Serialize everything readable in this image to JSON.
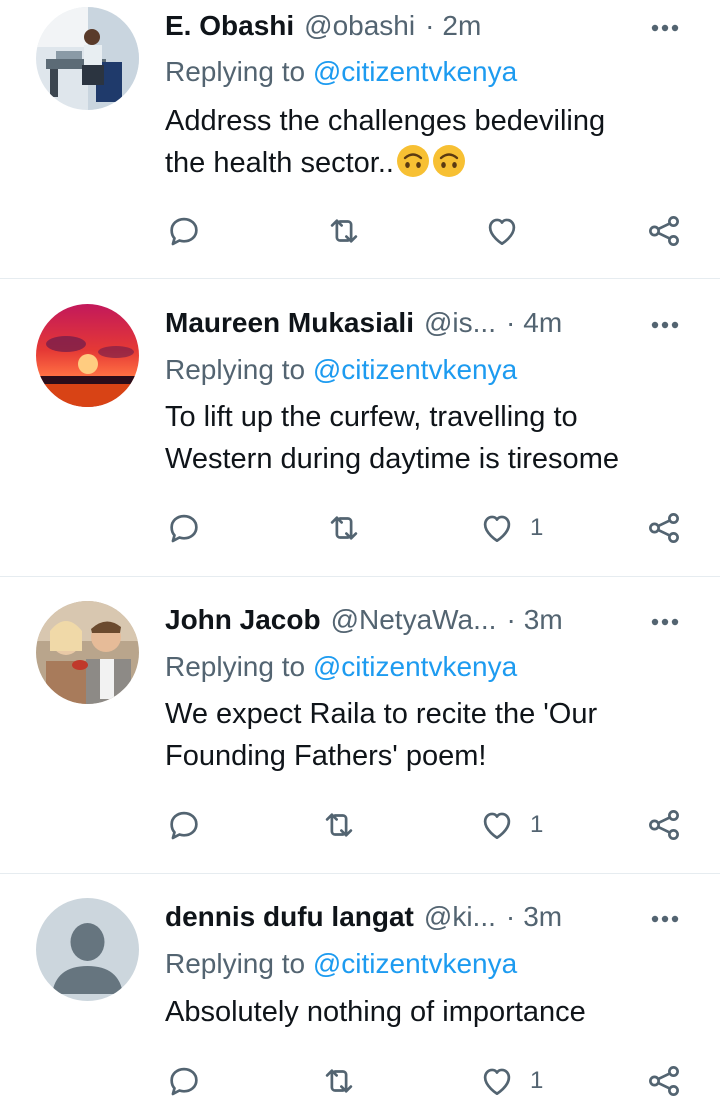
{
  "tweets": [
    {
      "display_name": "E. Obashi",
      "handle": "@obashi",
      "separator": "·",
      "time": "2m",
      "replying_prefix": "Replying to",
      "replying_to": "@citizentvkenya",
      "text_line1": "Address the challenges bedeviling",
      "text_line2": "the health sector..",
      "emoji": "upside-down-face-icon",
      "like_count": "",
      "avatar": "photo-man-at-desk"
    },
    {
      "display_name": "Maureen Mukasiali",
      "handle": "@is...",
      "separator": "·",
      "time": "4m",
      "replying_prefix": "Replying to",
      "replying_to": "@citizentvkenya",
      "text_line1": "To lift up the curfew, travelling to",
      "text_line2": "Western during daytime is tiresome",
      "like_count": "1",
      "avatar": "photo-sunset"
    },
    {
      "display_name": "John Jacob",
      "handle": "@NetyaWa...",
      "separator": "·",
      "time": "3m",
      "replying_prefix": "Replying to",
      "replying_to": "@citizentvkenya",
      "text_line1": "We expect Raila to recite the 'Our",
      "text_line2": "Founding Fathers' poem!",
      "like_count": "1",
      "avatar": "photo-couple"
    },
    {
      "display_name": "dennis dufu langat",
      "handle": "@ki...",
      "separator": "·",
      "time": "3m",
      "replying_prefix": "Replying to",
      "replying_to": "@citizentvkenya",
      "text_line1": "Absolutely nothing of importance",
      "like_count": "1",
      "avatar": "default-person-icon"
    }
  ],
  "icons": {
    "reply": "reply-icon",
    "retweet": "retweet-icon",
    "like": "heart-icon",
    "share": "share-icon",
    "more": "more-options-icon"
  },
  "colors": {
    "text": "#0f1419",
    "secondary": "#536471",
    "link": "#1d9bf0",
    "divider": "#e6ecf0"
  }
}
